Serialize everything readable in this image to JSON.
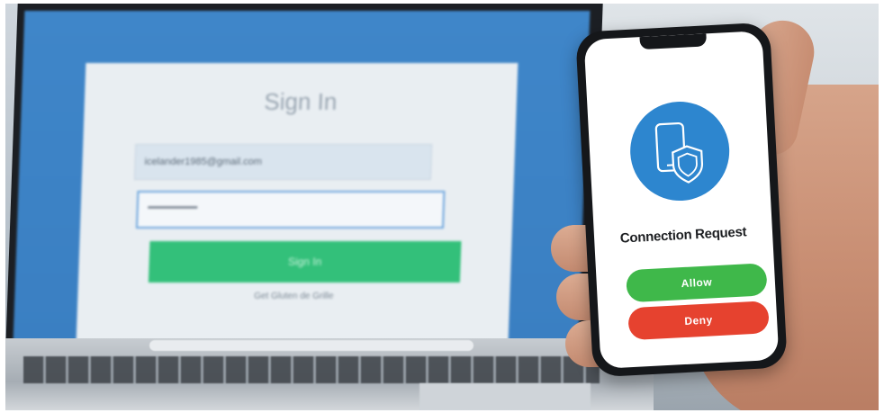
{
  "laptop": {
    "signin_title": "Sign In",
    "email_value": "icelander1985@gmail.com",
    "password_value": "••••••••••••••••••••••",
    "signin_button_label": "Sign In",
    "signin_link": "Get Gluten de Grille"
  },
  "phone": {
    "request_title": "Connection Request",
    "allow_label": "Allow",
    "deny_label": "Deny"
  },
  "colors": {
    "badge_blue": "#2d86cf",
    "allow_green": "#3fb84a",
    "deny_red": "#e6422f",
    "signin_green": "#33c07a",
    "laptop_screen_blue": "#3f86c9"
  },
  "icons": [
    "phone-shield-icon"
  ]
}
